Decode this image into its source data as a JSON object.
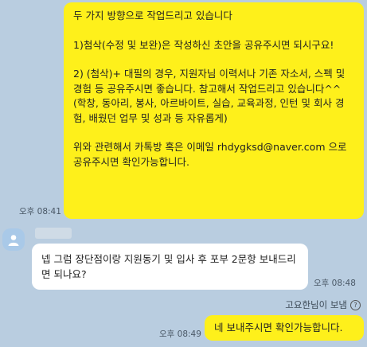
{
  "messages": {
    "out1": {
      "paragraphs": [
        "두 가지 방향으로 작업드리고 있습니다",
        "1)첨삭(수정 및 보완)은 작성하신 초안을 공유주시면 되시구요!",
        "2) (첨삭)+ 대필의 경우, 지원자님 이력서나 기존 자소서, 스펙 및 경험 등 공유주시면 좋습니다. 참고해서 작업드리고 있습니다^^\n(학창, 동아리, 봉사, 아르바이트, 실습, 교육과정, 인턴 및 회사 경험, 배웠던 업무 및 성과 등 자유롭게)",
        "위와 관련해서 카톡방 혹은 이메일 rhdygksd@naver.com 으로 공유주시면 확인가능합니다."
      ],
      "time": "오후 08:41"
    },
    "in1": {
      "text": "넵 그럼 장단점이랑 지원동기 및 입사 후 포부 2문항 보내드리면 되나요?",
      "time": "오후 08:48"
    },
    "notice": "고요한님이 보냄",
    "out2": {
      "text": "네 보내주시면 확인가능합니다.",
      "time": "오후 08:49"
    }
  },
  "colors": {
    "background": "#b9cde0",
    "outgoing_bubble": "#fef01b",
    "incoming_bubble": "#ffffff"
  },
  "icons": {
    "avatar": "person-icon",
    "help": "question-circle-icon"
  }
}
